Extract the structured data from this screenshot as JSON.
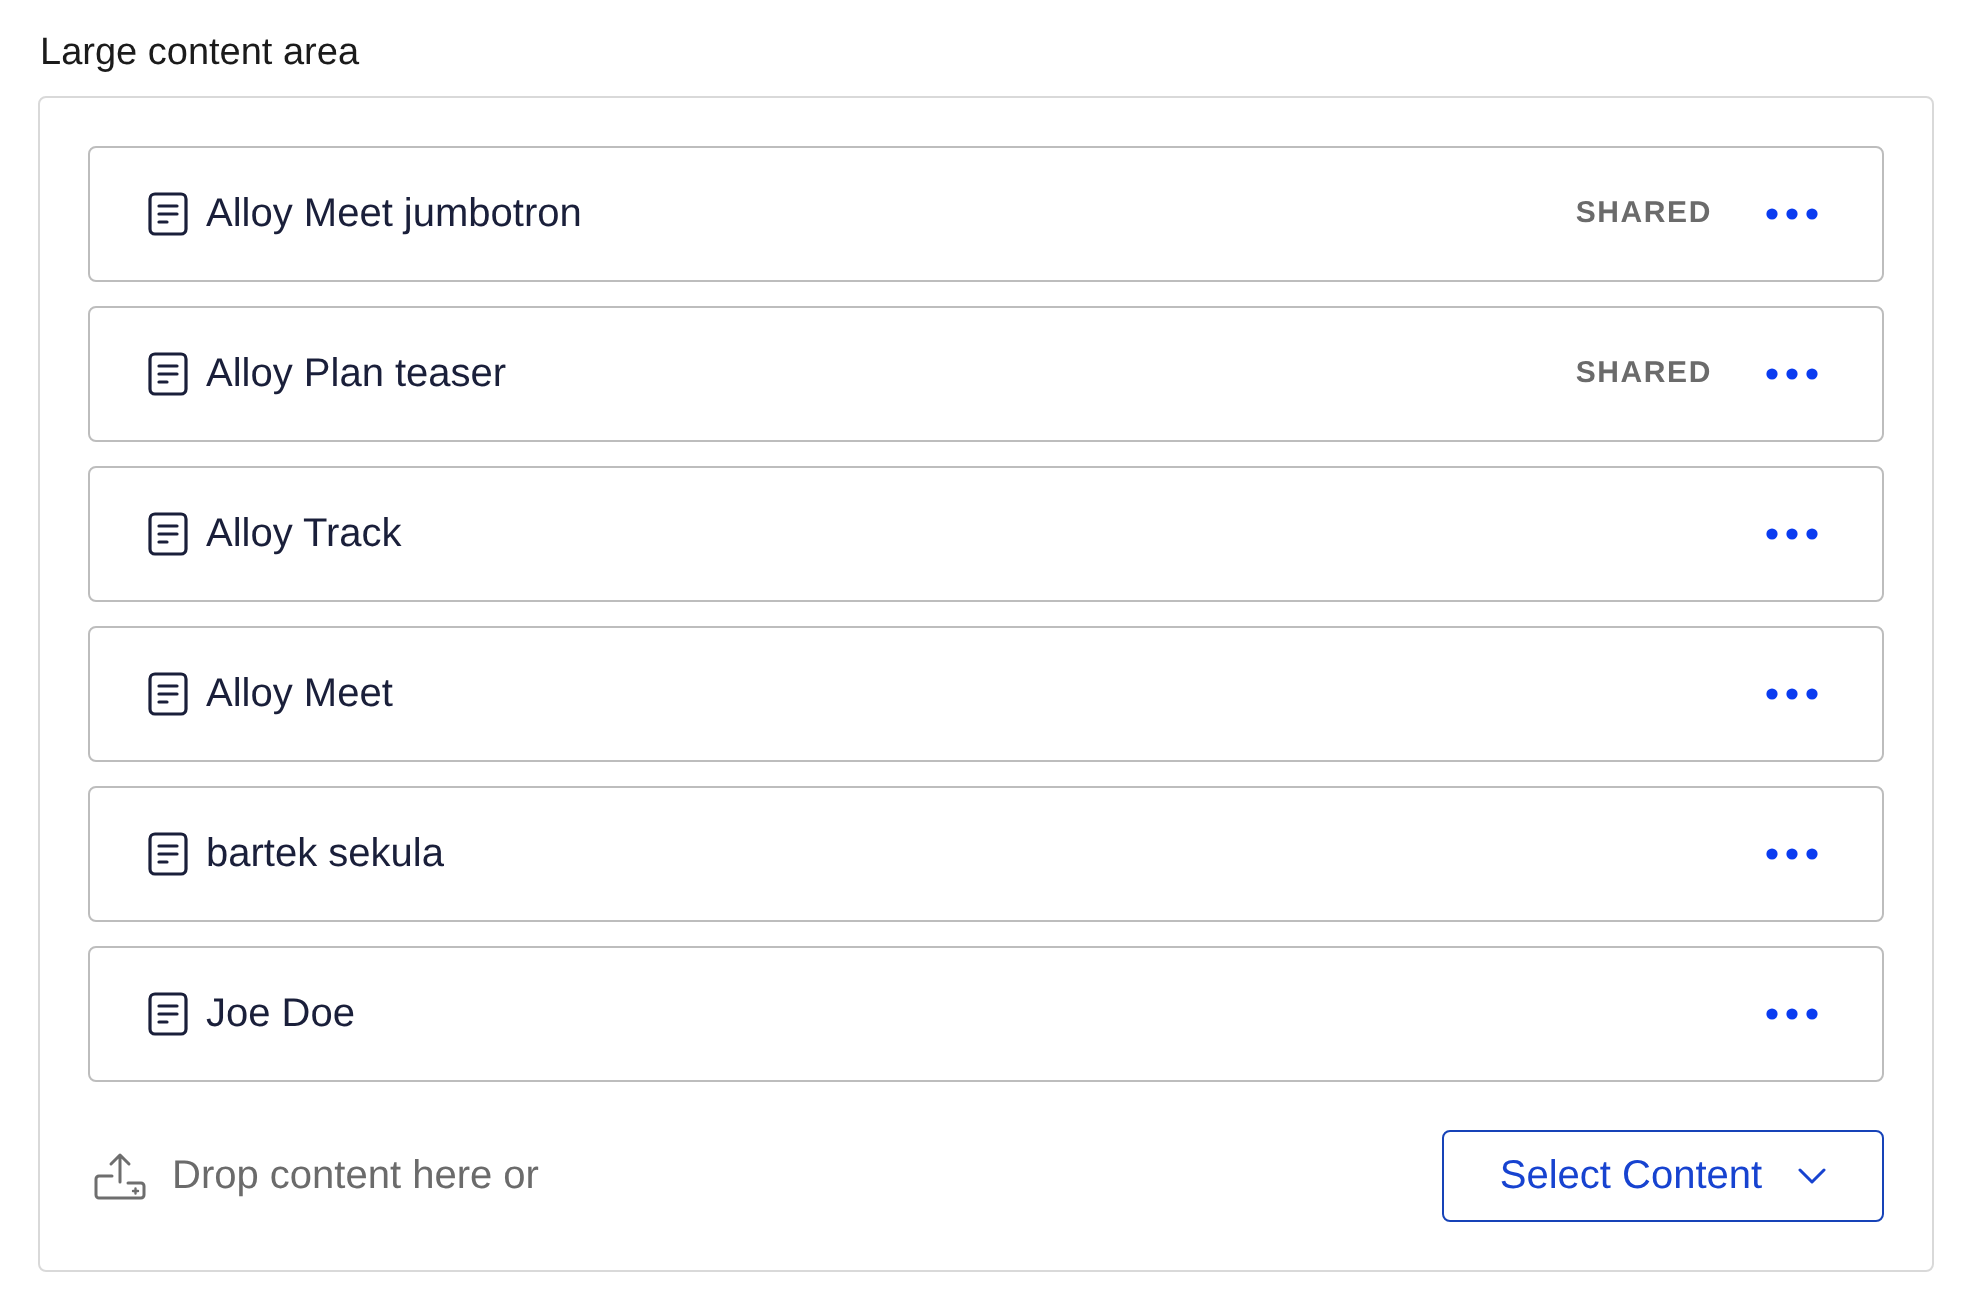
{
  "section": {
    "label": "Large content area"
  },
  "items": [
    {
      "title": "Alloy Meet jumbotron",
      "badge": "SHARED"
    },
    {
      "title": "Alloy Plan teaser",
      "badge": "SHARED"
    },
    {
      "title": "Alloy Track"
    },
    {
      "title": "Alloy Meet"
    },
    {
      "title": "bartek sekula"
    },
    {
      "title": "Joe Doe"
    }
  ],
  "drop_zone": {
    "text": "Drop content here or"
  },
  "select_button": {
    "label": "Select Content"
  }
}
